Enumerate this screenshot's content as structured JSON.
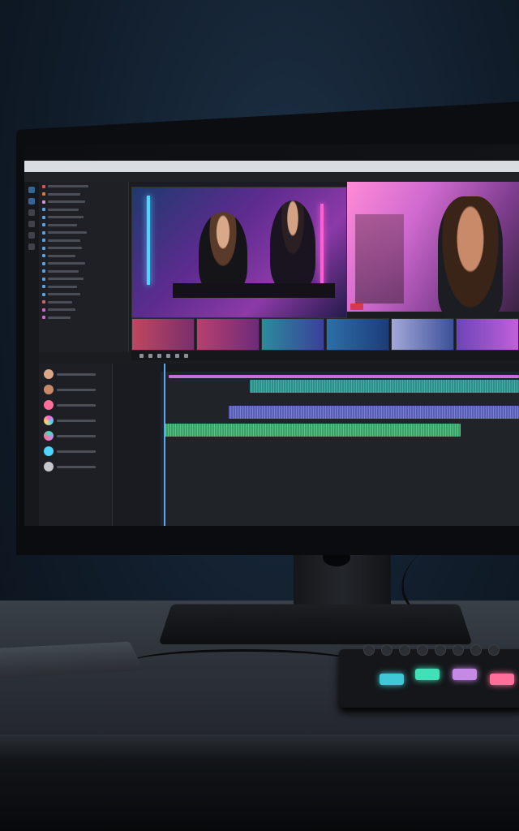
{
  "scene": {
    "description_tags": [
      "video-editor",
      "monitor",
      "desk",
      "midi-controller",
      "laptop"
    ],
    "colors": {
      "accent_blue": "#3b79b5",
      "neon_cyan": "#4fd5ff",
      "neon_pink": "#ff5fd2",
      "track_teal": "#43b2a6",
      "track_violet": "#7a7fd6",
      "track_green": "#58c486",
      "pad_cyan": "#41c8d8",
      "pad_teal": "#43e0b8",
      "pad_violet": "#c58ae6",
      "pad_pink": "#ff6f9a"
    }
  },
  "editor": {
    "icons": [
      "search-icon",
      "scissors-icon",
      "play-icon",
      "pause-icon",
      "skip-icon",
      "folder-icon"
    ]
  }
}
